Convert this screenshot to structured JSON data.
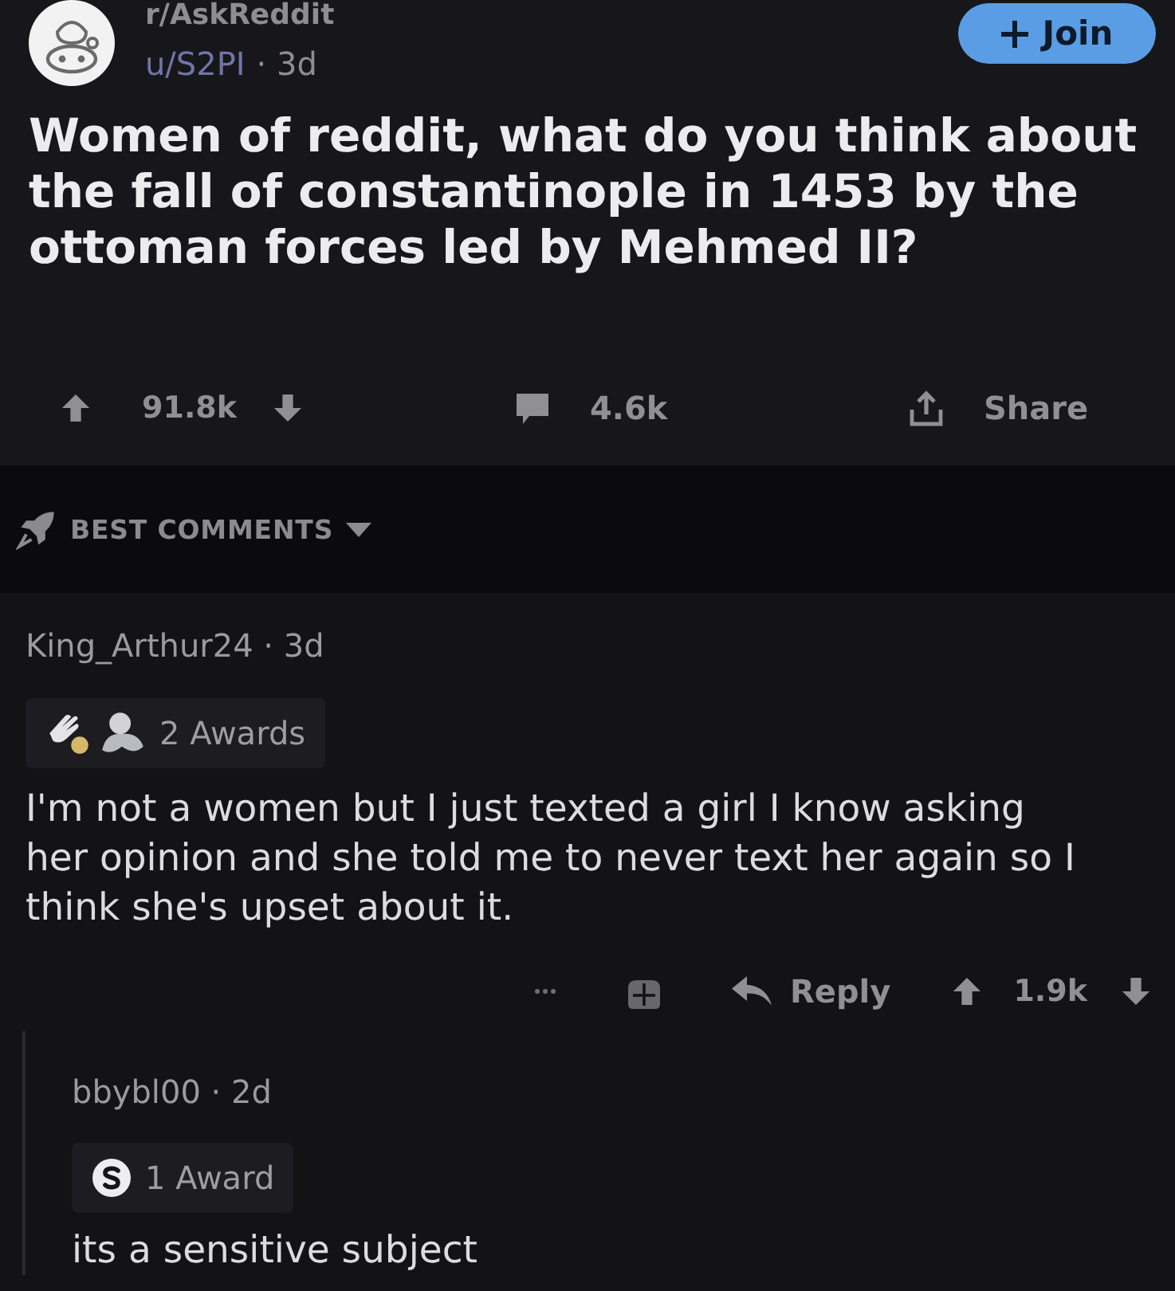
{
  "post": {
    "subreddit": "r/AskReddit",
    "author": "u/S2PI",
    "separator": "·",
    "age": "3d",
    "join_label": "Join",
    "title": "Women of reddit, what do you think about the fall of constantinople in 1453 by the ottoman forces led by Mehmed II?",
    "score": "91.8k",
    "comment_count": "4.6k",
    "share_label": "Share"
  },
  "sort": {
    "label": "BEST COMMENTS"
  },
  "comments": [
    {
      "author": "King_Arthur24",
      "separator": "·",
      "age": "3d",
      "awards": {
        "label": "2 Awards",
        "items": [
          {
            "kind": "hand"
          },
          {
            "kind": "hug"
          }
        ]
      },
      "body": "I'm not a women but I just texted a girl I know asking her opinion and she told me to never text her again so I think she's upset about it.",
      "actions": {
        "reply_label": "Reply",
        "score": "1.9k"
      },
      "children": [
        {
          "author": "bbybl00",
          "separator": "·",
          "age": "2d",
          "awards": {
            "label": "1 Award",
            "items": [
              {
                "kind": "coin"
              }
            ]
          },
          "body": "its a sensitive subject"
        }
      ]
    }
  ]
}
